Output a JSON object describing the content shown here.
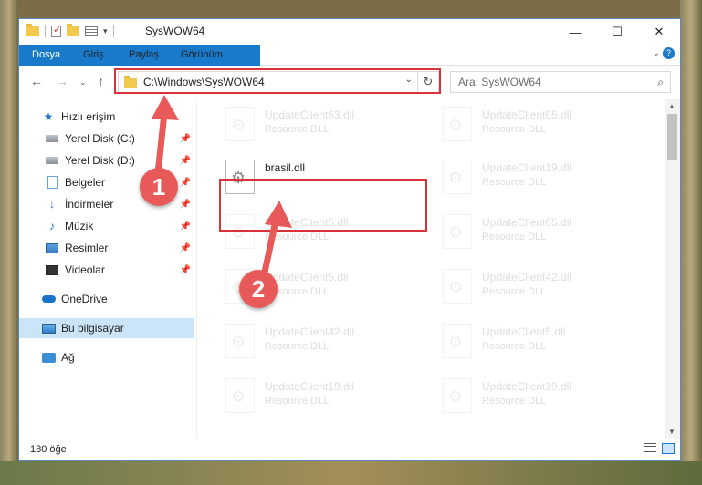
{
  "window": {
    "title": "SysWOW64",
    "controls": {
      "minimize": "—",
      "maximize": "☐",
      "close": "✕"
    }
  },
  "ribbon": {
    "tabs": [
      "Dosya",
      "Giriş",
      "Paylaş",
      "Görünüm"
    ]
  },
  "navigation": {
    "address_path": "C:\\Windows\\SysWOW64",
    "search_placeholder": "Ara: SysWOW64"
  },
  "sidebar": {
    "items": [
      {
        "label": "Hızlı erişim",
        "icon": "star-icon"
      },
      {
        "label": "Yerel Disk (C:)",
        "icon": "drive-icon",
        "pinned": true
      },
      {
        "label": "Yerel Disk (D:)",
        "icon": "drive-icon",
        "pinned": true
      },
      {
        "label": "Belgeler",
        "icon": "document-icon",
        "pinned": true
      },
      {
        "label": "İndirmeler",
        "icon": "download-icon",
        "pinned": true
      },
      {
        "label": "Müzik",
        "icon": "music-icon",
        "pinned": true
      },
      {
        "label": "Resimler",
        "icon": "pictures-icon",
        "pinned": true
      },
      {
        "label": "Videolar",
        "icon": "video-icon",
        "pinned": true
      },
      {
        "label": "OneDrive",
        "icon": "cloud-icon"
      },
      {
        "label": "Bu bilgisayar",
        "icon": "computer-icon",
        "selected": true
      },
      {
        "label": "Ağ",
        "icon": "network-icon"
      }
    ]
  },
  "files": [
    {
      "name": "UpdateClient63.dll",
      "type": "Resource DLL"
    },
    {
      "name": "UpdateClient65.dll",
      "type": "Resource DLL"
    },
    {
      "name": "brasil.dll",
      "type": "",
      "highlighted": true
    },
    {
      "name": "UpdateClient19.dll",
      "type": "Resource DLL"
    },
    {
      "name": "UpdateClient5.dll",
      "type": "Resource DLL"
    },
    {
      "name": "UpdateClient65.dll",
      "type": "Resource DLL"
    },
    {
      "name": "UpdateClient5.dll",
      "type": "Resource DLL"
    },
    {
      "name": "UpdateClient42.dll",
      "type": "Resource DLL"
    },
    {
      "name": "UpdateClient42.dll",
      "type": "Resource DLL"
    },
    {
      "name": "UpdateClient5.dll",
      "type": "Resource DLL"
    },
    {
      "name": "UpdateClient19.dll",
      "type": "Resource DLL"
    },
    {
      "name": "UpdateClient19.dll",
      "type": "Resource DLL"
    }
  ],
  "status": {
    "item_count": "180 öğe"
  },
  "annotations": {
    "step1": "1",
    "step2": "2",
    "color": "#e85a5a"
  }
}
